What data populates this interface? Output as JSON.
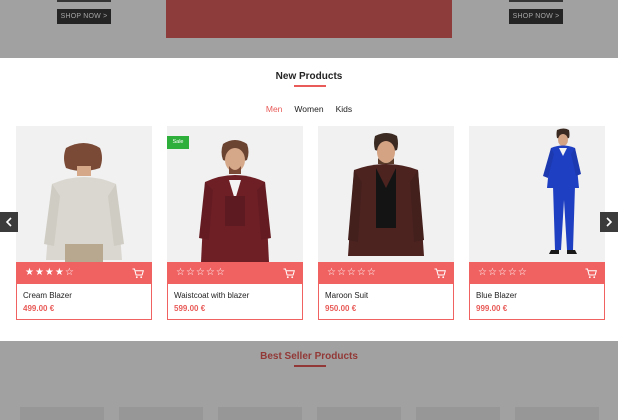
{
  "top_banner": {
    "left_button": "SHOP NOW >",
    "right_button": "SHOP NOW >"
  },
  "new_products": {
    "title": "New Products",
    "tabs": [
      {
        "label": "Men",
        "active": true
      },
      {
        "label": "Women",
        "active": false
      },
      {
        "label": "Kids",
        "active": false
      }
    ],
    "products": [
      {
        "name": "Cream Blazer",
        "price": "499.00 €",
        "rating": 4,
        "sale": false,
        "icon": "cart-icon"
      },
      {
        "name": "Waistcoat with blazer",
        "price": "599.00 €",
        "rating": 0,
        "sale": true,
        "badge": "Sale",
        "icon": "cart-icon"
      },
      {
        "name": "Maroon Suit",
        "price": "950.00 €",
        "rating": 0,
        "sale": false,
        "icon": "cart-icon"
      },
      {
        "name": "Blue Blazer",
        "price": "999.00 €",
        "rating": 0,
        "sale": false,
        "icon": "cart-icon"
      }
    ],
    "prev_icon": "chevron-left-icon",
    "next_icon": "chevron-right-icon"
  },
  "best_seller": {
    "title": "Best Seller Products"
  },
  "colors": {
    "accent": "#e85b58",
    "bar": "#f06262",
    "sale": "#2eae3a",
    "overlay": "rgba(0,0,0,0.37)"
  }
}
